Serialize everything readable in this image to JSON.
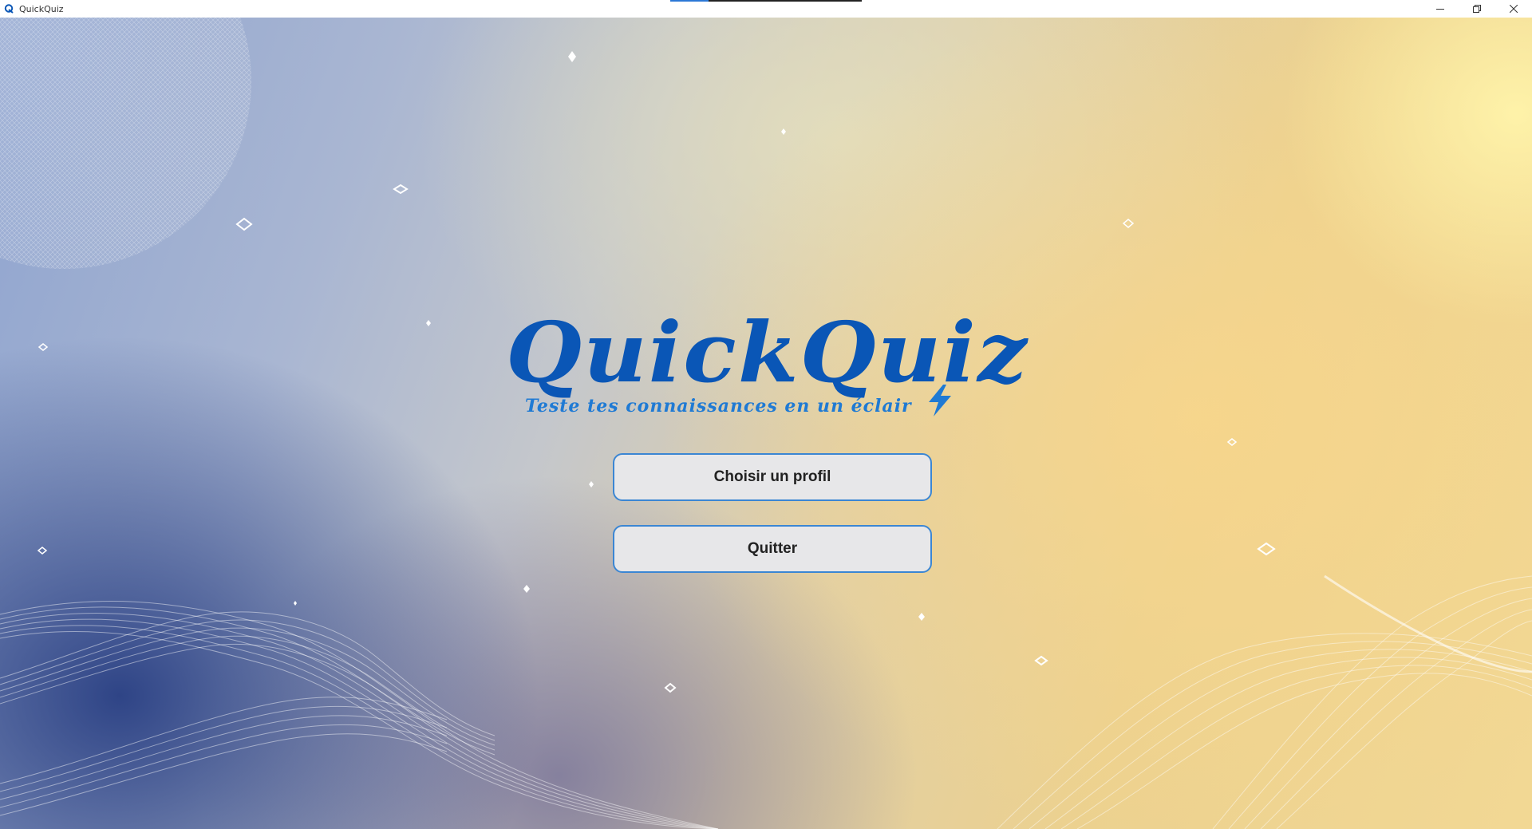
{
  "window": {
    "title": "QuickQuiz",
    "progress": 0.2,
    "controls": {
      "minimize_icon": "minimize-icon",
      "restore_icon": "restore-icon",
      "close_icon": "close-icon"
    }
  },
  "logo": {
    "title": "QuickQuiz",
    "tagline": "Teste tes connaissances en un éclair",
    "icon": "lightning-bolt-icon",
    "color": "#0a56b6",
    "tagline_color": "#1f7ad4"
  },
  "menu": {
    "choose_profile_label": "Choisir un profil",
    "quit_label": "Quitter"
  },
  "colors": {
    "button_border": "#3b86d3",
    "button_bg": "#e7e7e9",
    "bg_left": "#3a4f8f",
    "bg_right": "#f2d894"
  }
}
